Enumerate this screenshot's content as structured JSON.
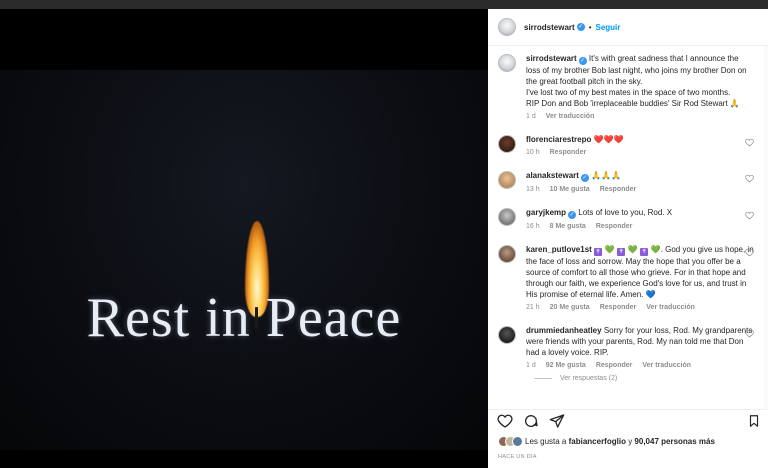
{
  "post": {
    "image_text": "Rest in Peace",
    "author": "sirrodstewart",
    "follow_label": "Seguir",
    "caption": "It's with great sadness that I announce the loss of my brother Bob last night, who joins my brother Don on the great football pitch in the sky.",
    "caption2": "I've lost two of my best mates in the space of two months.",
    "caption3": "RIP Don and Bob 'irreplaceable buddies' Sir Rod Stewart 🙏",
    "caption_time": "1 d",
    "caption_translate": "Ver traducción"
  },
  "comments": [
    {
      "user": "florenciarestrepo",
      "text": "❤️❤️❤️",
      "time": "10 h",
      "reply": "Responder"
    },
    {
      "user": "alanakstewart",
      "text": "🙏🙏🙏",
      "time": "13 h",
      "likes": "10 Me gusta",
      "reply": "Responder"
    },
    {
      "user": "garyjkemp",
      "text": "Lots of love to you, Rod. X",
      "time": "16 h",
      "likes": "8 Me gusta",
      "reply": "Responder"
    },
    {
      "user": "karen_putlove1st",
      "text_tail": ". God you give us hope, in the face of loss and sorrow. May the hope that you offer be a source of comfort to all those who grieve. For in that hope and through our faith, we experience God's love for us, and trust in His promise of eternal life. Amen. 💙",
      "time": "21 h",
      "likes": "20 Me gusta",
      "reply": "Responder",
      "translate": "Ver traducción"
    },
    {
      "user": "drummiedanheatley",
      "text": "Sorry for your loss, Rod. My grandparents were friends with your parents, Rod. My nan told me that Don had a lovely voice. RIP.",
      "time": "1 d",
      "likes": "92 Me gusta",
      "reply": "Responder",
      "translate": "Ver traducción"
    }
  ],
  "replies_label": "Ver respuestas (2)",
  "likes_line": {
    "prefix": "Les gusta a",
    "user": "fabiancerfoglio",
    "mid": "y",
    "count": "90,047 personas más"
  },
  "posted_ago": "HACE UN DÍA",
  "colors": {
    "accent": "#0095f6",
    "verified": "#3897f0"
  }
}
